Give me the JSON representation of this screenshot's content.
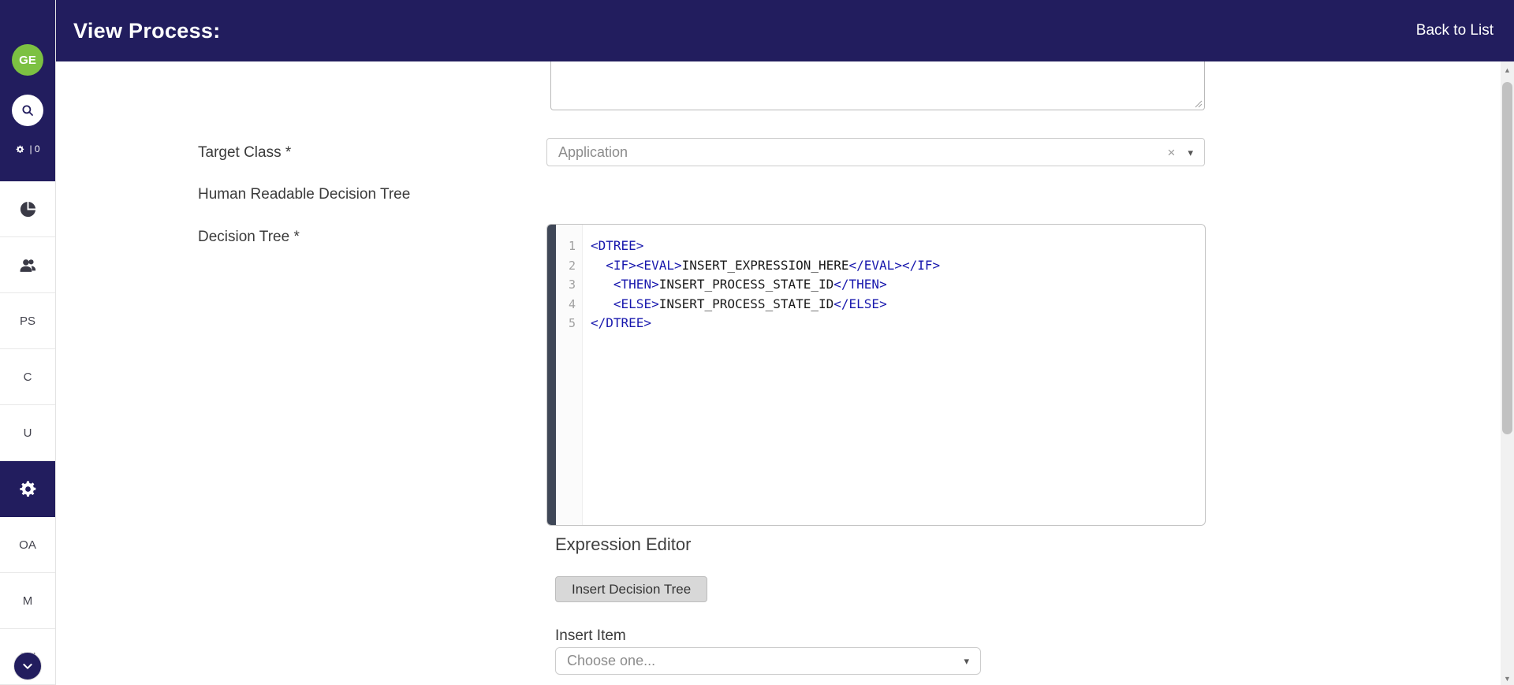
{
  "header": {
    "title": "View Process:",
    "back_link": "Back to List"
  },
  "sidebar": {
    "avatar": "GE",
    "counter": "| 0",
    "items": [
      {
        "id": "reports",
        "icon": "pie-chart-icon"
      },
      {
        "id": "users",
        "icon": "users-icon"
      },
      {
        "label": "PS"
      },
      {
        "label": "C"
      },
      {
        "label": "U"
      },
      {
        "id": "settings",
        "icon": "gear-icon",
        "active": true
      },
      {
        "label": "OA"
      },
      {
        "label": "M"
      },
      {
        "label": "SU"
      }
    ]
  },
  "form": {
    "target_class_label": "Target Class *",
    "target_class_value": "Application",
    "human_readable_label": "Human Readable Decision Tree",
    "decision_tree_label": "Decision Tree *",
    "expression_editor_heading": "Expression Editor",
    "insert_button_label": "Insert Decision Tree",
    "insert_item_label": "Insert Item",
    "insert_item_placeholder": "Choose one..."
  },
  "editor": {
    "lines": [
      "<DTREE>",
      "  <IF><EVAL>INSERT_EXPRESSION_HERE</EVAL></IF>",
      "   <THEN>INSERT_PROCESS_STATE_ID</THEN>",
      "   <ELSE>INSERT_PROCESS_STATE_ID</ELSE>",
      "</DTREE>"
    ]
  },
  "icons": {
    "clear": "×",
    "caret": "▾",
    "up": "▲",
    "down": "▼"
  },
  "colors": {
    "navy": "#221d5e",
    "green": "#7cc142",
    "tag_blue": "#1717ad"
  }
}
